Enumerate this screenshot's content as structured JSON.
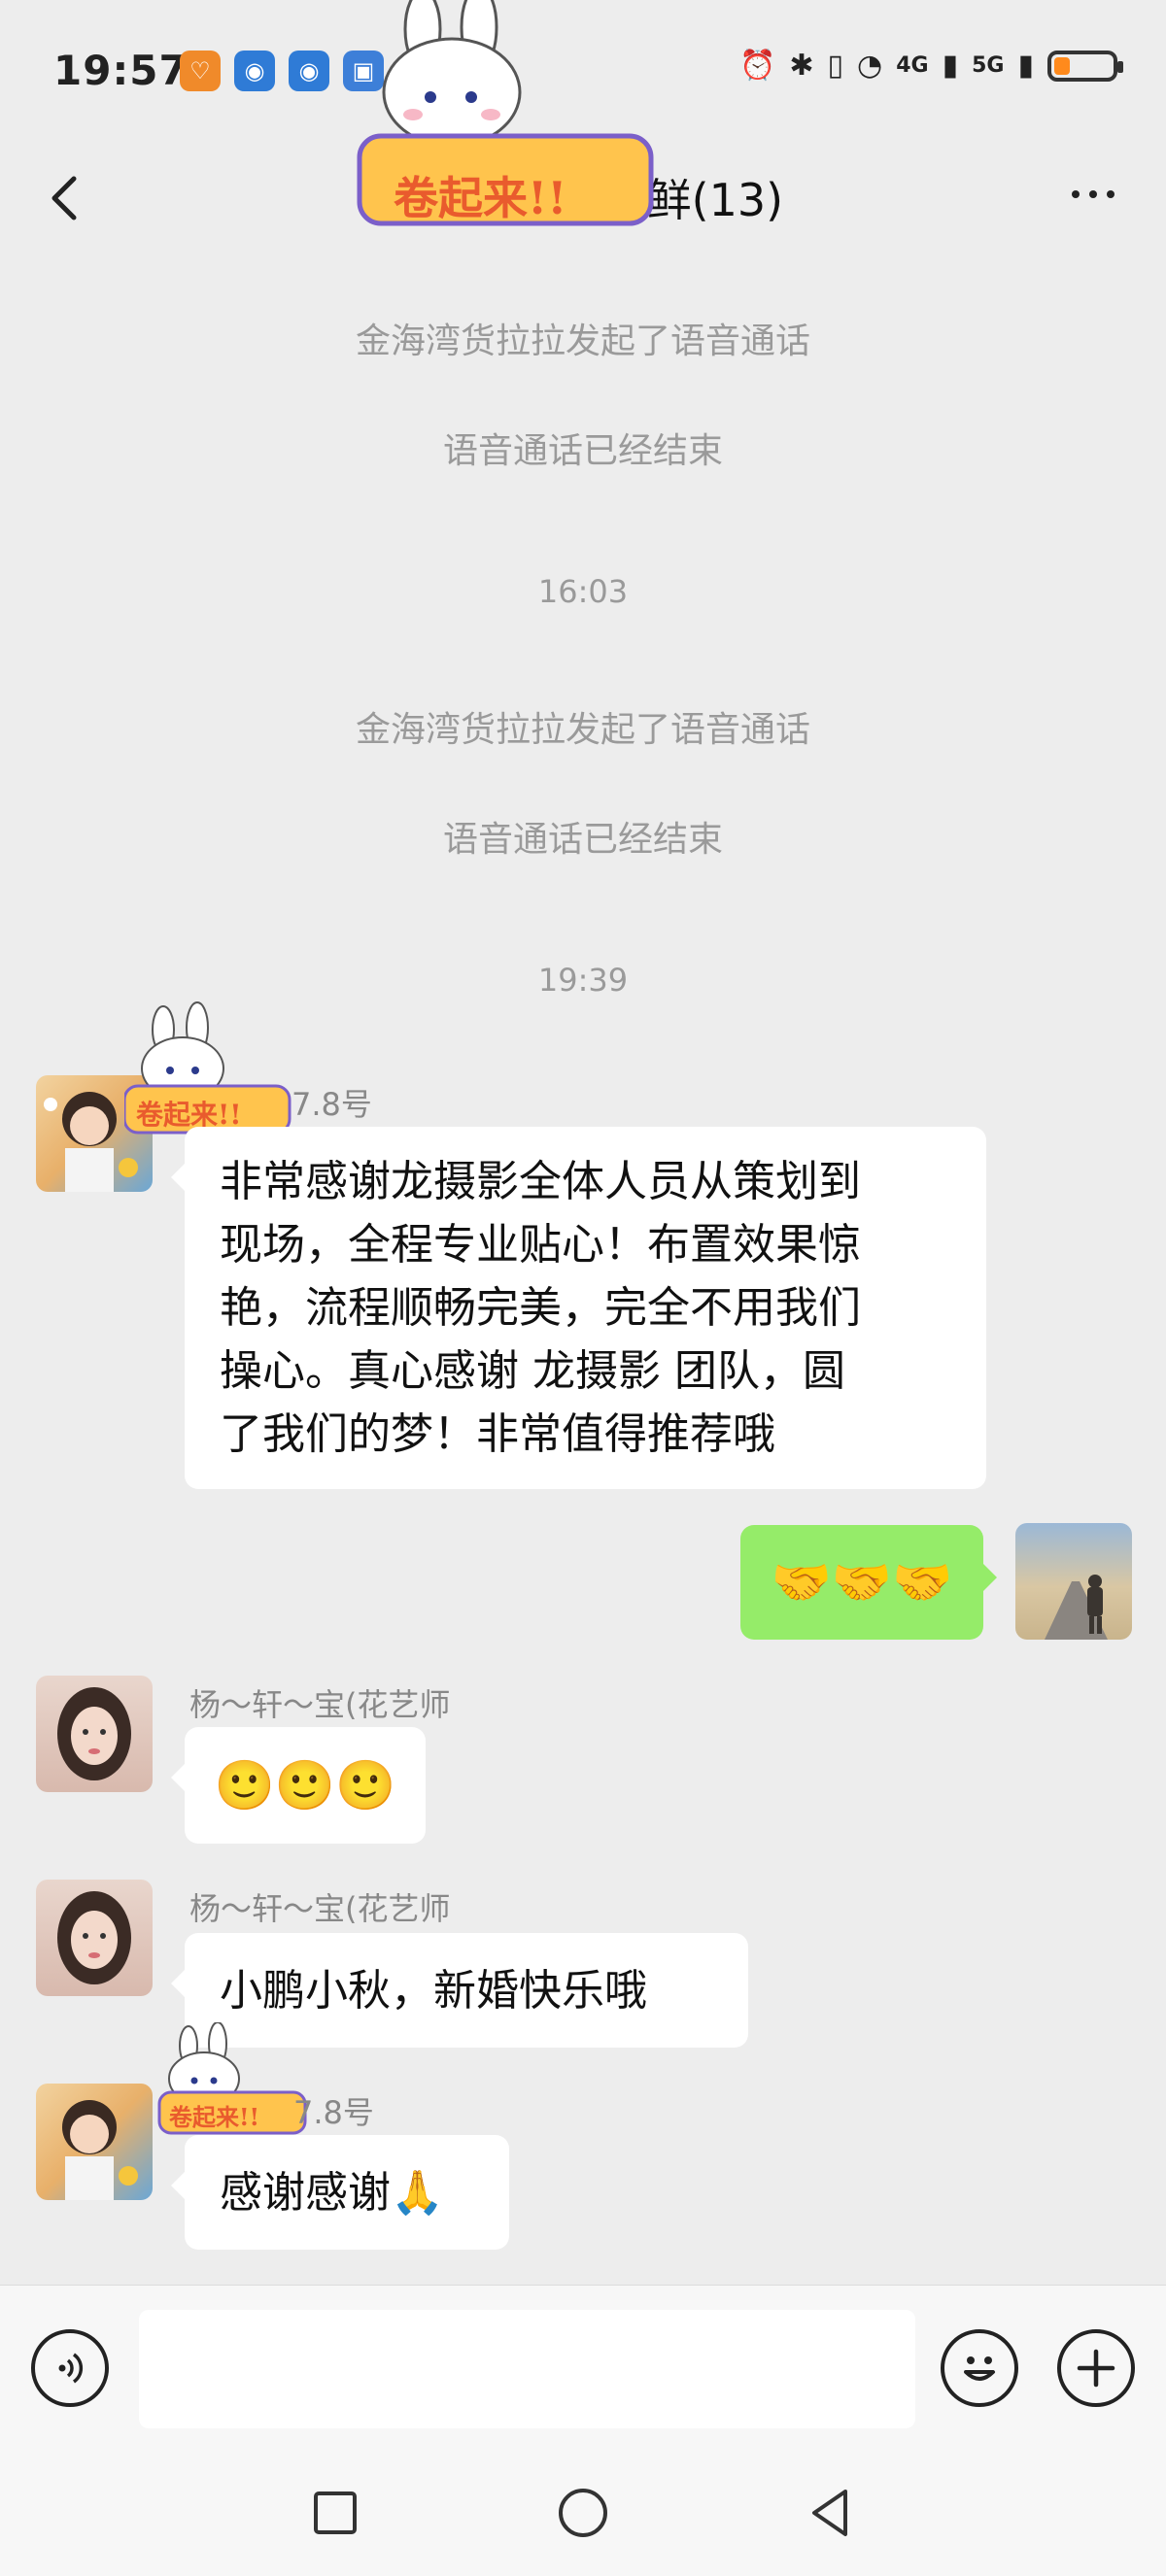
{
  "status_bar": {
    "time": "19:57",
    "network_4g": "4G",
    "network_5g": "5G",
    "battery_level": 0.25
  },
  "header": {
    "title": "7.8号 秋美味鲜(13)",
    "sticker_text": "卷起来!!"
  },
  "system_messages": [
    {
      "text": "金海湾货拉拉发起了语音通话"
    },
    {
      "text": "语音通话已经结束"
    },
    {
      "time": "16:03"
    },
    {
      "text": "金海湾货拉拉发起了语音通话"
    },
    {
      "text": "语音通话已经结束"
    },
    {
      "time": "19:39"
    }
  ],
  "messages": [
    {
      "sender": "7.8号",
      "side": "left",
      "text": "非常感谢龙摄影全体人员从策划到现场，全程专业贴心！布置效果惊艳，流程顺畅完美，完全不用我们操心。真心感谢 龙摄影 团队，圆了我们的梦！非常值得推荐哦",
      "lines": [
        "非常感谢龙摄影全体人员从策划到",
        "现场，全程专业贴心！布置效果惊",
        "艳，流程顺畅完美，完全不用我们",
        "操心。真心感谢 龙摄影 团队，圆",
        "了我们的梦！非常值得推荐哦"
      ]
    },
    {
      "sender": "",
      "side": "right",
      "text": "🤝🤝🤝"
    },
    {
      "sender": "杨～轩～宝(花艺师",
      "side": "left",
      "text": "🙂🙂🙂"
    },
    {
      "sender": "杨～轩～宝(花艺师",
      "side": "left",
      "text": "小鹏小秋，新婚快乐哦"
    },
    {
      "sender": "7.8号",
      "side": "left",
      "text": "感谢感谢🙏"
    }
  ],
  "input_bar": {
    "placeholder": ""
  },
  "icons": {
    "back": "chevron-left-icon",
    "more": "more-dots-icon",
    "voice": "voice-icon",
    "emoji": "emoji-icon",
    "plus": "plus-icon"
  },
  "colors": {
    "background": "#ededed",
    "outgoing_bubble": "#95ec69",
    "incoming_bubble": "#ffffff",
    "battery": "#ff8a1c"
  }
}
